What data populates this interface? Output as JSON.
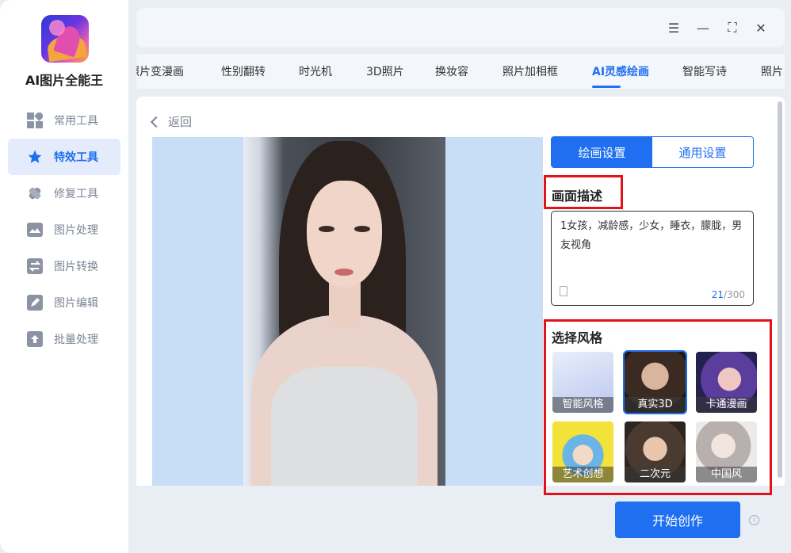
{
  "app": {
    "name": "AI图片全能王"
  },
  "sidebar": {
    "items": [
      {
        "label": "常用工具",
        "icon": "grid-icon"
      },
      {
        "label": "特效工具",
        "icon": "star-icon",
        "active": true
      },
      {
        "label": "修复工具",
        "icon": "bandage-icon"
      },
      {
        "label": "图片处理",
        "icon": "image-icon"
      },
      {
        "label": "图片转换",
        "icon": "swap-icon"
      },
      {
        "label": "图片编辑",
        "icon": "edit-icon"
      },
      {
        "label": "批量处理",
        "icon": "upload-icon"
      }
    ]
  },
  "window": {
    "menu_icon": "☰",
    "minimize_icon": "—",
    "maximize_icon": "⛶",
    "close_icon": "✕"
  },
  "tabs": [
    {
      "label": "照片变漫画"
    },
    {
      "label": "性别翻转"
    },
    {
      "label": "时光机"
    },
    {
      "label": "3D照片"
    },
    {
      "label": "换妆容"
    },
    {
      "label": "照片加相框"
    },
    {
      "label": "AI灵感绘画",
      "active": true
    },
    {
      "label": "智能写诗"
    },
    {
      "label": "照片"
    }
  ],
  "back": {
    "label": "返回"
  },
  "settings": {
    "tab_active": "绘画设置",
    "tab_other": "通用设置"
  },
  "description": {
    "title": "画面描述",
    "text": "1女孩，减龄感，少女，睡衣，朦胧，男友视角",
    "count_current": "21",
    "count_max": "/300"
  },
  "styles": {
    "title": "选择风格",
    "items": [
      {
        "label": "智能风格"
      },
      {
        "label": "真实3D",
        "selected": true
      },
      {
        "label": "卡通漫画"
      },
      {
        "label": "艺术创想"
      },
      {
        "label": "二次元"
      },
      {
        "label": "中国风"
      }
    ]
  },
  "actions": {
    "start_label": "开始创作",
    "info_icon": "i"
  },
  "colors": {
    "accent": "#1f6ff0",
    "highlight": "#e0141a"
  }
}
